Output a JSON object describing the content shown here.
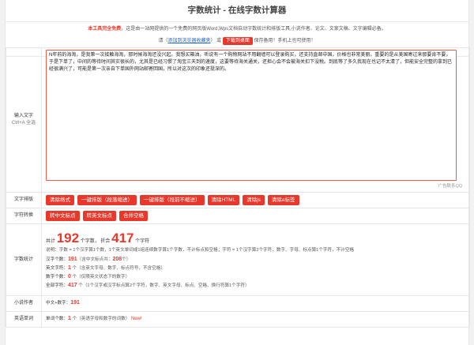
{
  "title": "字数统计 - 在线字数计算器",
  "notice": {
    "free": "本工具完全免费",
    "desc": "，这是由一站网提供的一个免费的网页版Word,Wps文档自动字数统计和排版工具,小说作者、论文、文案文稿、文字编辑必备。",
    "please": "请（",
    "add_link": "添加到浏览器收藏夹",
    "paren_close": "）",
    "or": "或",
    "download_btn": "下载到桌面",
    "save_hint": "保存备用！手机上也可使用！"
  },
  "input_label": "输入文字",
  "input_shortcut": "Ctrl+A 全选",
  "input_text": "N年前的海淘，是我第一次接触海淘，那时候海淘还没兴起。我想买箱油，听说有一个购物网站不用翻墙可以登录购买，还支持直邮中国，价格也非常美丽。重要的是从美国寄过来那要肯不要，于是下单了，中间的等待时间其实很长的，尤其是已经习惯了淘宝三天到的速度，这要等待海关通关，还担心会不会被海关扣下没税。到底等了多久我现在也记不太清了，但能安全完整的拿到已经很满兴了，可能是第一次亲自下单国外网站邮寄回国，所以对这次的印象还挺深的。",
  "ad_text": "广告联系QQ",
  "typeset": {
    "label": "文字排版",
    "buttons": [
      "清除格式",
      "一键排版（段落缩进）",
      "一键排版（段前不缩进）",
      "清除HTML",
      "清除js",
      "清除a标签"
    ]
  },
  "convert": {
    "label": "字符转换",
    "buttons": [
      "转中文标点",
      "转英文标点",
      "合并空格"
    ]
  },
  "stats": {
    "label": "字数统计",
    "total_prefix": "共计",
    "total_words": "192",
    "words_unit": "个字数，",
    "fold_prefix": "折合",
    "total_chars": "417",
    "chars_unit": "个字符",
    "note": "说明：字数 = 1个汉字算1个数，1个英文单词或1组连续数字算1个字数，不计标点和空格；字符 = 1个汉字算2个字符，数字、字母、标点算1个字符，不计空格",
    "hanzi_label": "汉字个数：",
    "hanzi_count": "191",
    "hanzi_note": "（含中文标点共：",
    "hanzi_punct": "208",
    "hanzi_note_end": "个）",
    "english_label": "英文字符：",
    "english_count": "1",
    "english_note": "个（含英文字母、数字、标点符号，不含空格）",
    "digit_label": "数字个数：",
    "digit_count": "0",
    "digit_note": "个（仅限英文状态下的数字）",
    "all_label": "全部字符：",
    "all_count": "417",
    "all_note": "个（1个汉字或汉字标点算2个字符，数字、英文字母、标点、空格、换行符算1个字符）"
  },
  "novel": {
    "label": "小说作者",
    "text": "中文+数字：",
    "value": "191"
  },
  "english_words": {
    "label": "英语单词",
    "prefix": "单词个数：",
    "value": "1",
    "suffix": "个（英语字母和数字的词数）",
    "new_tag": "New!"
  }
}
